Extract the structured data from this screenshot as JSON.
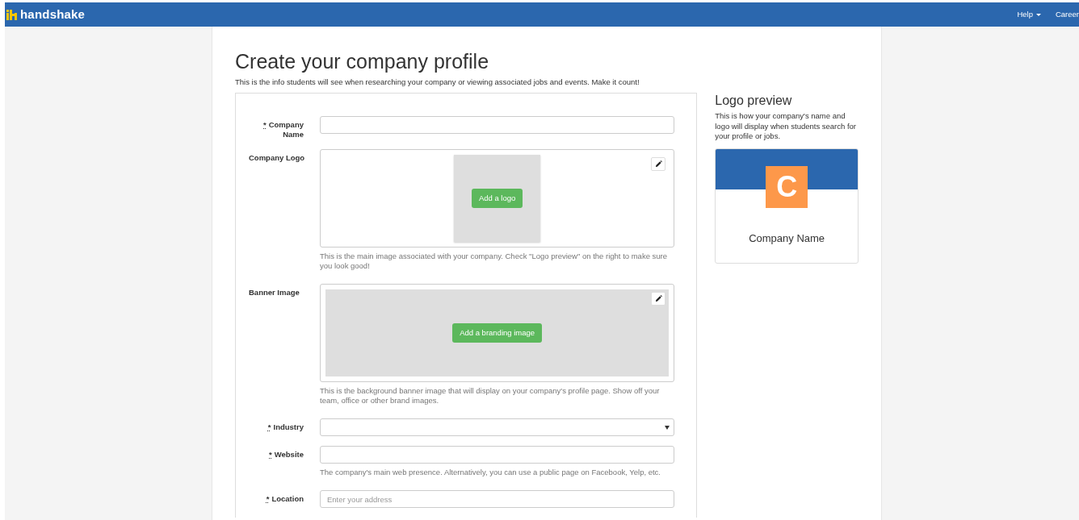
{
  "navbar": {
    "brand": "handshake",
    "links": [
      {
        "label": "Help",
        "dropdown": true
      },
      {
        "label": "Career",
        "dropdown": false
      }
    ]
  },
  "page": {
    "title": "Create your company profile",
    "subtitle": "This is the info students will see when researching your company or viewing associated jobs and events. Make it count!"
  },
  "form": {
    "fields": [
      {
        "kind": "text",
        "label": "Company Name",
        "required_mark": "*"
      },
      {
        "kind": "logo",
        "label": "Company Logo",
        "button": "Add a logo",
        "help": "This is the main image associated with your company. Check \"Logo preview\" on the right to make sure you look good!"
      },
      {
        "kind": "banner",
        "label": "Banner Image",
        "button": "Add a branding image",
        "help": "This is the background banner image that will display on your company's profile page. Show off your team, office or other brand images."
      },
      {
        "kind": "select",
        "label": "Industry",
        "required_mark": "*"
      },
      {
        "kind": "text",
        "label": "Website",
        "required_mark": "*",
        "help": "The company's main web presence. Alternatively, you can use a public page on Facebook, Yelp, etc."
      },
      {
        "kind": "text",
        "label": "Location",
        "required_mark": "*",
        "placeholder": "Enter your address"
      }
    ]
  },
  "logo_preview": {
    "title": "Logo preview",
    "text": "This is how your company's name and logo will display when students search for your profile or jobs.",
    "initial": "C",
    "company_name": "Company Name"
  }
}
